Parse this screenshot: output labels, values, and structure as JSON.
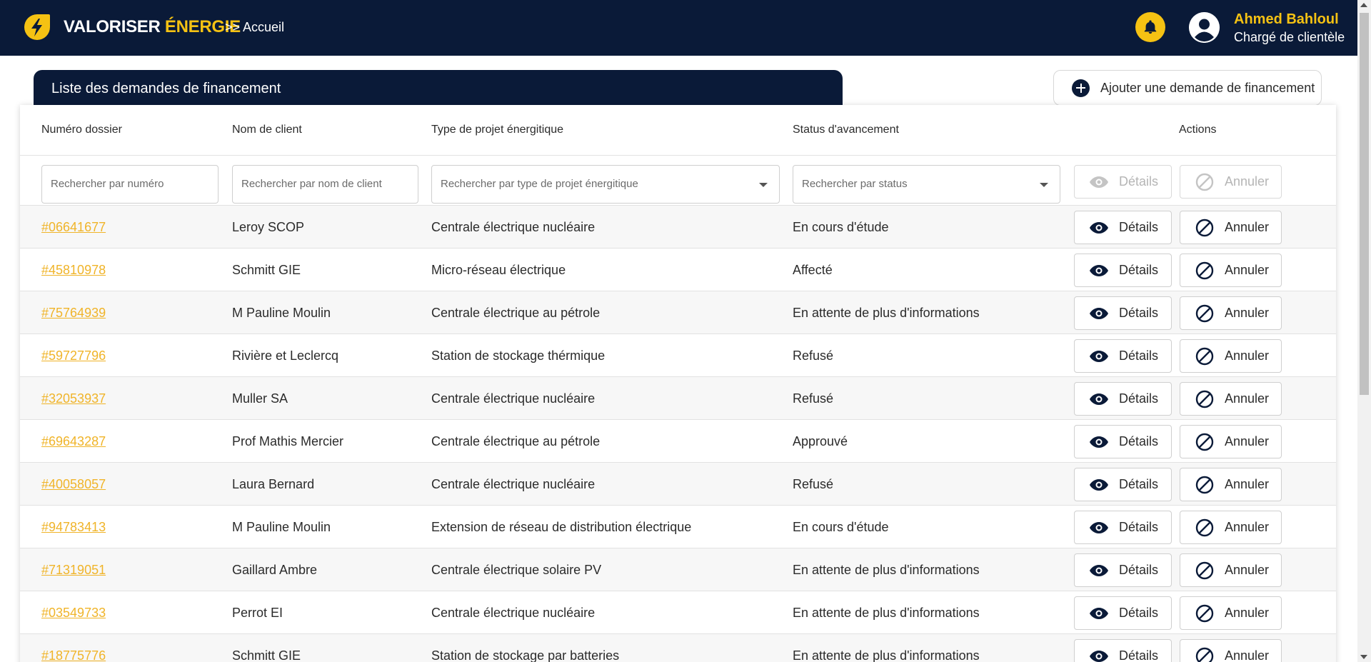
{
  "header": {
    "brand_main": "VALORISER ",
    "brand_accent": "ÉNERGIE",
    "breadcrumb": ">> Accueil",
    "user_name": "Ahmed Bahloul",
    "user_role": "Chargé de clientèle",
    "icons": [
      "lightning-logo-icon",
      "bell-icon",
      "user-avatar-icon"
    ]
  },
  "page": {
    "list_title": "Liste des demandes de financement",
    "add_button_label": "Ajouter une demande de financement"
  },
  "table": {
    "columns": [
      "Numéro dossier",
      "Nom de client",
      "Type de projet énergitique",
      "Status d'avancement",
      "Actions"
    ],
    "filters": {
      "numero_placeholder": "Rechercher par numéro",
      "client_placeholder": "Rechercher par nom de client",
      "type_placeholder": "Rechercher par type de projet énergitique",
      "status_placeholder": "Rechercher par status"
    },
    "action_labels": {
      "details": "Détails",
      "annuler": "Annuler"
    },
    "rows": [
      {
        "numero": "#06641677",
        "client": "Leroy SCOP",
        "type": "Centrale électrique nucléaire",
        "status": "En cours d'étude"
      },
      {
        "numero": "#45810978",
        "client": "Schmitt GIE",
        "type": "Micro-réseau électrique",
        "status": "Affecté"
      },
      {
        "numero": "#75764939",
        "client": "M Pauline Moulin",
        "type": "Centrale électrique au pétrole",
        "status": "En attente de plus d'informations"
      },
      {
        "numero": "#59727796",
        "client": "Rivière et Leclercq",
        "type": "Station de stockage thérmique",
        "status": "Refusé"
      },
      {
        "numero": "#32053937",
        "client": "Muller SA",
        "type": "Centrale électrique nucléaire",
        "status": "Refusé"
      },
      {
        "numero": "#69643287",
        "client": "Prof Mathis Mercier",
        "type": "Centrale électrique au pétrole",
        "status": "Approuvé"
      },
      {
        "numero": "#40058057",
        "client": "Laura Bernard",
        "type": "Centrale électrique nucléaire",
        "status": "Refusé"
      },
      {
        "numero": "#94783413",
        "client": "M Pauline Moulin",
        "type": "Extension de réseau de distribution électrique",
        "status": "En cours d'étude"
      },
      {
        "numero": "#71319051",
        "client": "Gaillard Ambre",
        "type": "Centrale électrique solaire PV",
        "status": "En attente de plus d'informations"
      },
      {
        "numero": "#03549733",
        "client": "Perrot EI",
        "type": "Centrale électrique nucléaire",
        "status": "En attente de plus d'informations"
      },
      {
        "numero": "#18775776",
        "client": "Schmitt GIE",
        "type": "Station de stockage par batteries",
        "status": "En attente de plus d'informations"
      }
    ]
  },
  "colors": {
    "navy": "#0a1a38",
    "accent_yellow": "#f5c213",
    "link_orange": "#f0b429"
  }
}
